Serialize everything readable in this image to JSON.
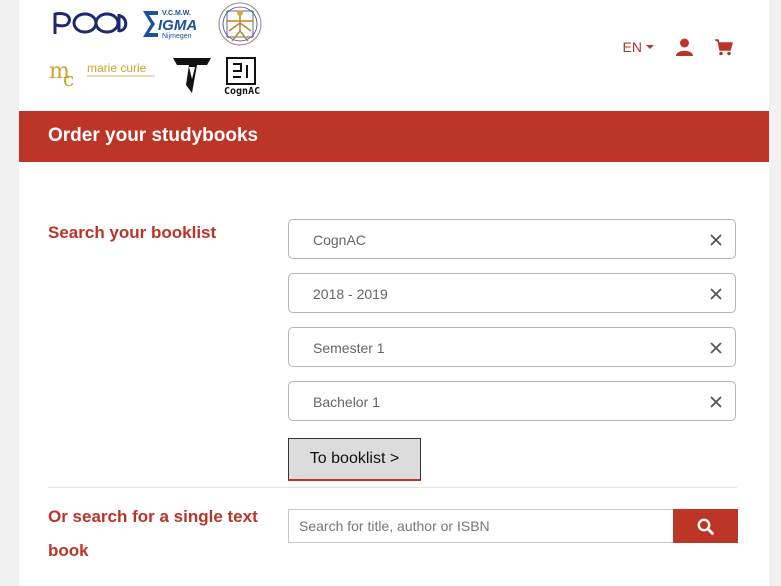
{
  "header": {
    "logos": [
      {
        "name": "desda-logo",
        "text": "PCOA"
      },
      {
        "name": "sigma-logo",
        "text": "V.C.M.W. SIGMA Nijmegen"
      },
      {
        "name": "vitruvian-logo",
        "text": ""
      },
      {
        "name": "marie-curie-logo",
        "text": "mc marie curie"
      },
      {
        "name": "t-logo",
        "text": "T"
      },
      {
        "name": "cognac-logo",
        "text": "CognAC"
      }
    ],
    "language": "EN",
    "icons": {
      "account": "user-icon",
      "cart": "cart-icon"
    }
  },
  "title": "Order your studybooks",
  "booklist": {
    "label": "Search your booklist",
    "fields": [
      {
        "value": "CognAC"
      },
      {
        "value": "2018 - 2019"
      },
      {
        "value": "Semester 1"
      },
      {
        "value": "Bachelor 1"
      }
    ],
    "button_label": "To booklist >"
  },
  "single": {
    "label": "Or search for a single text book",
    "placeholder": "Search for title, author or ISBN"
  },
  "colors": {
    "accent": "#bd3527",
    "background": "#f1f1f1"
  }
}
